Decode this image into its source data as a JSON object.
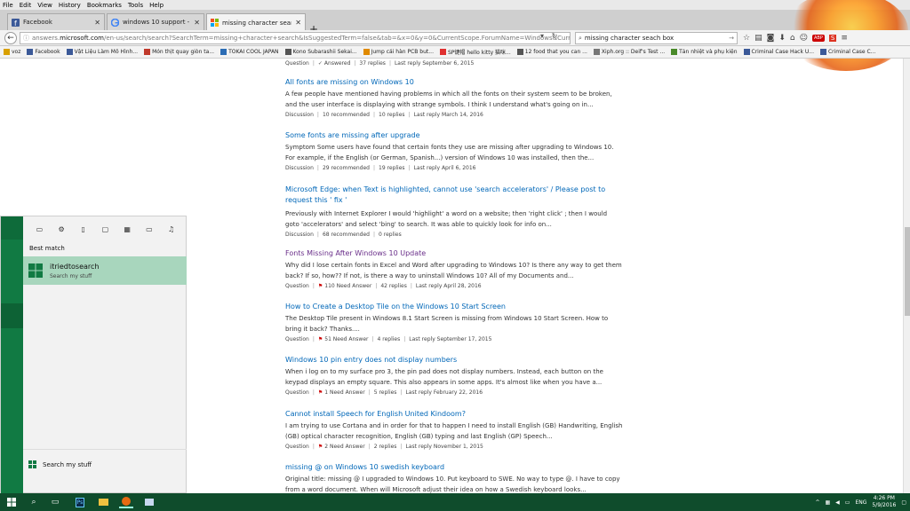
{
  "menu": [
    "File",
    "Edit",
    "View",
    "History",
    "Bookmarks",
    "Tools",
    "Help"
  ],
  "tabs": [
    {
      "title": "Facebook",
      "icon": "facebook-icon",
      "active": false
    },
    {
      "title": "windows 10 support - Tim...",
      "icon": "google-icon",
      "active": false
    },
    {
      "title": "missing character search ...",
      "icon": "microsoft-icon",
      "active": true
    }
  ],
  "nav": {
    "url_prefix": "answers.",
    "url_host": "microsoft.com",
    "url_rest": "/en-us/search/search?SearchTerm=missing+character+search&IsSuggestedTerm=false&tab=&x=0&y=0&CurrentScope.ForumName=Windows&Curr",
    "search_value": "missing character seach box"
  },
  "bookmarks": [
    {
      "label": "voz",
      "color": "#d9a000"
    },
    {
      "label": "Facebook",
      "color": "#3b5998"
    },
    {
      "label": "Vật Liệu Làm Mô Hình...",
      "color": "#3b5998"
    },
    {
      "label": "Món thịt quay giòn ta...",
      "color": "#c0392b"
    },
    {
      "label": "TOKAI COOL JAPAN",
      "color": "#2c6db5"
    },
    {
      "label": "Kono Subarashii Sekai...",
      "color": "#555555"
    },
    {
      "label": "Jump cái hàn PCB but...",
      "color": "#e08a00"
    },
    {
      "label": "SP键帽 hello kitty 猫咪...",
      "color": "#e03030"
    },
    {
      "label": "12 food that you can ...",
      "color": "#555555"
    },
    {
      "label": "Xiph.org :: Deif's Test ...",
      "color": "#777777"
    },
    {
      "label": "Tản nhiệt và phụ kiện",
      "color": "#4a8a2a"
    },
    {
      "label": "Criminal Case Hack U...",
      "color": "#3b5998"
    },
    {
      "label": "Criminal Case C...",
      "color": "#3b5998"
    }
  ],
  "results": [
    {
      "title": "",
      "desc": "",
      "meta_type": "Question",
      "meta_status": "Answered",
      "meta_replies": "37 replies",
      "meta_last": "Last reply September 6, 2015"
    },
    {
      "title": "All fonts are missing on Windows 10",
      "visited": false,
      "desc": "A few people have mentioned having problems in which all the fonts on their system seem to be broken, and the user interface is displaying with strange symbols. I think I understand what's going on in...",
      "meta_type": "Discussion",
      "meta_status": "10 recommended",
      "meta_replies": "10 replies",
      "meta_last": "Last reply March 14, 2016"
    },
    {
      "title": "Some fonts are missing after upgrade",
      "visited": false,
      "desc": "Symptom Some users have found that certain fonts they use are missing after upgrading to Windows 10. For example, if the English (or German, Spanish...) version of Windows 10 was installed, then the...",
      "meta_type": "Discussion",
      "meta_status": "29 recommended",
      "meta_replies": "19 replies",
      "meta_last": "Last reply April 6, 2016"
    },
    {
      "title": "Microsoft Edge: when Text is highlighted, cannot use 'search accelerators' / Please post to request this ' fix '",
      "visited": false,
      "desc": "Previously with Internet Explorer I would 'highlight' a word on a website; then 'right click' ; then I would goto 'accelerators' and select 'bing' to search. It was able to quickly look for info on...",
      "meta_type": "Discussion",
      "meta_status": "68 recommended",
      "meta_replies": "0 replies",
      "meta_last": ""
    },
    {
      "title": "Fonts Missing After Windows 10 Update",
      "visited": true,
      "desc": "Why did I lose certain fonts in Excel and Word after upgrading to Windows 10? Is there any way to get them back? If so, how?? If not, is there a way to uninstall Windows 10? All of my Documents and...",
      "meta_type": "Question",
      "meta_status": "110 Need Answer",
      "meta_replies": "42 replies",
      "meta_last": "Last reply April 28, 2016"
    },
    {
      "title": "How to Create a Desktop Tile on the Windows 10 Start Screen",
      "visited": false,
      "desc": "The Desktop Tile present in Windows 8.1 Start Screen is missing from Windows 10 Start Screen. How to bring it back? Thanks....",
      "meta_type": "Question",
      "meta_status": "51 Need Answer",
      "meta_replies": "4 replies",
      "meta_last": "Last reply September 17, 2015"
    },
    {
      "title": "Windows 10 pin entry does not display numbers",
      "visited": false,
      "desc": "When i log on to my surface pro 3, the pin pad does not display numbers. Instead, each button on the keypad displays an empty square. This also appears in some apps. It's almost like when you have a...",
      "meta_type": "Question",
      "meta_status": "1 Need Answer",
      "meta_replies": "5 replies",
      "meta_last": "Last reply February 22, 2016"
    },
    {
      "title": "Cannot install Speech for English United Kindoom?",
      "visited": false,
      "desc": "I am trying to use Cortana and in order for that to happen I need to install English (GB) Handwriting, English (GB) optical character recognition, English (GB) typing and last English (GP) Speech...",
      "meta_type": "Question",
      "meta_status": "2 Need Answer",
      "meta_replies": "2 replies",
      "meta_last": "Last reply November 1, 2015"
    },
    {
      "title": "missing @ on Windows 10 swedish keyboard",
      "visited": false,
      "desc": "Original title: missing @ I upgraded to Windows 10. Put keyboard to SWE. No way to type @. I have to copy from a word document. When will Microsoft adjust their idea on how a Swedish keyboard looks...",
      "meta_type": "",
      "meta_status": "",
      "meta_replies": "",
      "meta_last": ""
    }
  ],
  "start_panel": {
    "best_match_label": "Best match",
    "match_title": "itriedtosearch",
    "match_subtitle": "Search my stuff",
    "search_my_stuff": "Search my stuff"
  },
  "taskbar": {
    "lang": "ENG",
    "time": "4:26 PM",
    "date": "5/9/2016",
    "color": "#0f4c2c"
  }
}
